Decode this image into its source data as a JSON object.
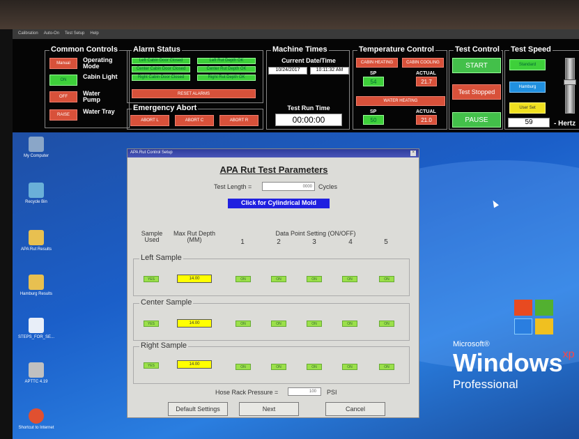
{
  "menu": [
    "Calibration",
    "Auto-On",
    "Test Setup",
    "Help"
  ],
  "common_controls": {
    "title": "Common Controls",
    "rows": [
      {
        "button": "Manual",
        "label": "Operating Mode",
        "style": "red"
      },
      {
        "button": "ON",
        "label": "Cabin Light",
        "style": "green"
      },
      {
        "button": "OFF",
        "label": "Water Pump",
        "style": "red"
      },
      {
        "button": "RAISE",
        "label": "Water Tray",
        "style": "red"
      }
    ]
  },
  "alarm_status": {
    "title": "Alarm Status",
    "alarms": [
      "Left Cabin Door Closed",
      "Left Rut Depth OK",
      "Center Cabin Door Closed",
      "Center Rut Depth OK",
      "Right Cabin Door Closed",
      "Right Rut Depth OK"
    ],
    "reset": "RESET ALARMS"
  },
  "emergency_abort": {
    "title": "Emergency Abort",
    "buttons": [
      "ABORT L",
      "ABORT C",
      "ABORT R"
    ]
  },
  "machine_times": {
    "title": "Machine Times",
    "current_label": "Current Date/Time",
    "date": "10/24/2017",
    "time": "10:11:32 AM",
    "run_label": "Test Run Time",
    "run_time": "00:00:00"
  },
  "temperature": {
    "title": "Temperature Control",
    "cabin_heating": "CABIN HEATING",
    "cabin_cooling": "CABIN COOLING",
    "sp_label": "SP",
    "actual_label": "ACTUAL",
    "cabin_sp": "54",
    "cabin_actual": "21.7",
    "water_heating": "WATER HEATING",
    "water_sp": "50",
    "water_actual": "21.0"
  },
  "test_control": {
    "title": "Test Control",
    "start": "START",
    "stopped": "Test Stopped",
    "pause": "PAUSE"
  },
  "test_speed": {
    "title": "Test Speed",
    "standard": "Standard",
    "hamburg": "Hamburg",
    "user_set": "User Set",
    "value": "59",
    "unit": "- Hertz"
  },
  "desktop_icons": [
    "My Computer",
    "Recycle Bin",
    "APA Rut Results",
    "Hamburg Results",
    "STEPS_FOR_SE...",
    "APTTC 4.19",
    "Shortcut to Internet"
  ],
  "xp": {
    "microsoft": "Microsoft®",
    "windows": "Windows",
    "xp": "xp",
    "edition": "Professional"
  },
  "dialog": {
    "title": "APA Rut Control Setup",
    "close": "×",
    "heading": "APA Rut Test Parameters",
    "test_length_label": "Test Length =",
    "test_length_value": "0000",
    "cycles": "Cycles",
    "mold_button": "Click for Cylindrical Mold",
    "col_sample": "Sample Used",
    "col_maxrut": "Max Rut Depth (MM)",
    "col_datapoint": "Data Point Setting (ON/OFF)",
    "points": [
      "1",
      "2",
      "3",
      "4",
      "5"
    ],
    "samples": [
      {
        "name": "Left Sample",
        "used": "YES",
        "depth": "14.00",
        "points": [
          "ON",
          "ON",
          "ON",
          "ON",
          "ON"
        ]
      },
      {
        "name": "Center Sample",
        "used": "YES",
        "depth": "14.00",
        "points": [
          "ON",
          "ON",
          "ON",
          "ON",
          "ON"
        ]
      },
      {
        "name": "Right Sample",
        "used": "YES",
        "depth": "14.00",
        "points": [
          "ON",
          "ON",
          "ON",
          "ON",
          "ON"
        ]
      }
    ],
    "hose_label": "Hose Rack Pressure =",
    "hose_value": "100",
    "psi": "PSI",
    "default_btn": "Default Settings",
    "next_btn": "Next",
    "cancel_btn": "Cancel"
  }
}
